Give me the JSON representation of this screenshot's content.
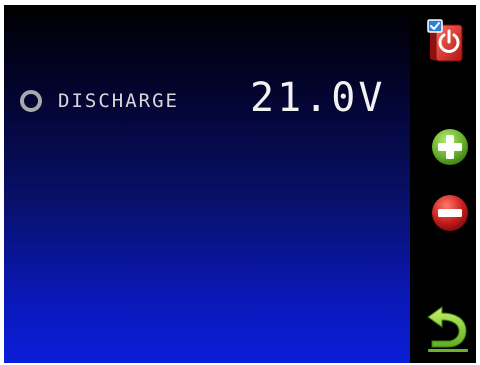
{
  "status": {
    "mode_label": "DISCHARGE",
    "mode_selected": false,
    "voltage": "21.0V"
  },
  "side_buttons": [
    {
      "icon": "power-icon"
    },
    {
      "icon": "plus-icon"
    },
    {
      "icon": "minus-icon"
    },
    {
      "icon": "back-arrow-icon"
    }
  ],
  "colors": {
    "background_top": "#000000",
    "background_bottom": "#0b1ed8",
    "plus_green": "#6ab32e",
    "minus_red": "#c81e1e",
    "back_green": "#8fd13a",
    "power_red": "#d62b2b"
  }
}
